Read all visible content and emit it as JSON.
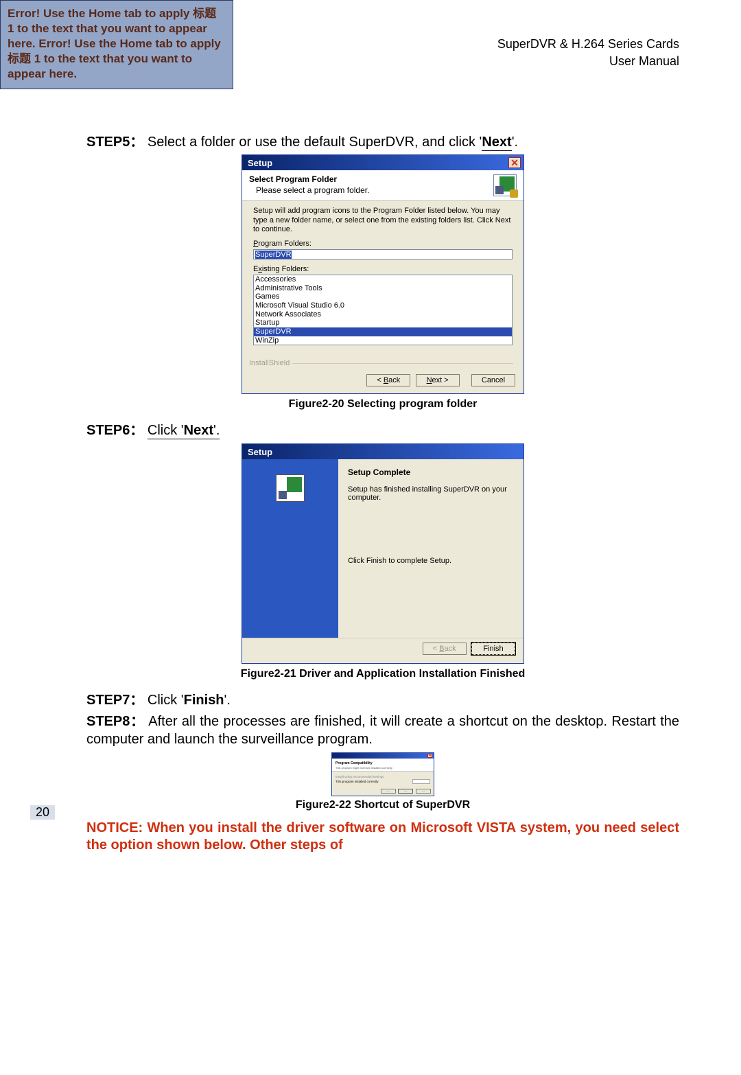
{
  "header": {
    "callout": "Error! Use the Home tab to apply 标题 1 to the text that you want to appear here. Error! Use the Home tab to apply 标题 1 to the text that you want to appear here.",
    "product_line1": "SuperDVR & H.264 Series Cards",
    "product_line2": "User  Manual"
  },
  "step5": {
    "label": "STEP5：",
    "text_before": "Select a folder or use the default SuperDVR, and click '",
    "next_word": "Next",
    "text_after": "'."
  },
  "dialog1": {
    "title": "Setup",
    "header_title": "Select Program Folder",
    "header_sub": "Please select a program folder.",
    "instruct": "Setup will add program icons to the Program Folder listed below. You may type a new folder name, or select one from the existing folders list. Click Next to continue.",
    "program_folders_label": "Program Folders:",
    "program_folder_value": "SuperDVR",
    "existing_label": "Existing Folders:",
    "existing": [
      "Accessories",
      "Administrative Tools",
      "Games",
      "Microsoft Visual Studio 6.0",
      "Network Associates",
      "Startup",
      "SuperDVR",
      "WinZip"
    ],
    "install_shield": "InstallShield",
    "btn_back": "< Back",
    "btn_next": "Next >",
    "btn_cancel": "Cancel"
  },
  "caption1": "Figure2-20 Selecting program folder",
  "step6": {
    "label": "STEP6：",
    "text_before": "Click '",
    "next_word": "Next",
    "text_after": "'."
  },
  "dialog2": {
    "title": "Setup",
    "complete_hdr": "Setup Complete",
    "p1": "Setup has finished installing SuperDVR on your computer.",
    "p2": "Click Finish to complete Setup.",
    "btn_back": "< Back",
    "btn_finish": "Finish"
  },
  "caption2": "Figure2-21 Driver and Application Installation Finished",
  "step7": {
    "label": "STEP7：",
    "text_before": "Click '",
    "word": "Finish",
    "text_after": "'."
  },
  "step8": {
    "label": "STEP8：",
    "text": "After all the processes are finished, it will create a shortcut on the desktop. Restart the computer and launch the surveillance program."
  },
  "dialog3": {
    "t1": "Program Compatibility",
    "t2": "This program might not have installed correctly",
    "g1": "Install using recommended settings",
    "g2": "This program installed correctly",
    "btn1": "Cancel",
    "btn2": "Cancel"
  },
  "caption3": "Figure2-22 Shortcut of SuperDVR",
  "notice": "NOTICE: When you install the driver software on Microsoft VISTA system, you need select the option shown below. Other steps of",
  "page_number": "20"
}
